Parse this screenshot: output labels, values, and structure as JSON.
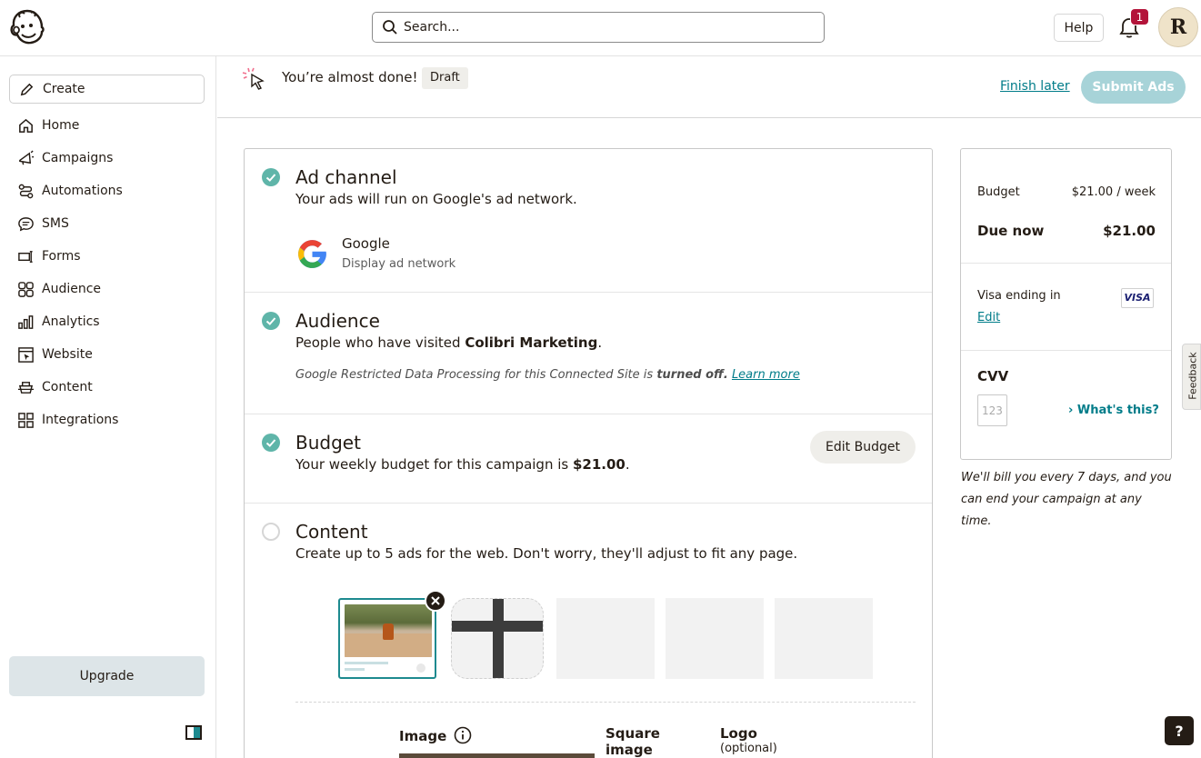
{
  "topbar": {
    "search_placeholder": "Search...",
    "help_label": "Help",
    "notification_count": "1",
    "avatar_initial": "R"
  },
  "sidebar": {
    "create_label": "Create",
    "items": [
      {
        "label": "Home",
        "icon": "home-icon"
      },
      {
        "label": "Campaigns",
        "icon": "megaphone-icon"
      },
      {
        "label": "Automations",
        "icon": "automation-icon"
      },
      {
        "label": "SMS",
        "icon": "chat-icon"
      },
      {
        "label": "Forms",
        "icon": "form-icon"
      },
      {
        "label": "Audience",
        "icon": "audience-icon"
      },
      {
        "label": "Analytics",
        "icon": "bar-chart-icon"
      },
      {
        "label": "Website",
        "icon": "website-icon"
      },
      {
        "label": "Content",
        "icon": "content-icon"
      },
      {
        "label": "Integrations",
        "icon": "grid-icon"
      }
    ],
    "upgrade_label": "Upgrade"
  },
  "header": {
    "status_text": "You’re almost done!",
    "draft_badge": "Draft",
    "finish_later": "Finish later",
    "submit_label": "Submit Ads"
  },
  "sections": {
    "ad_channel": {
      "title": "Ad channel",
      "text": "Your ads will run on Google's ad network.",
      "provider_name": "Google",
      "provider_sub": "Display ad network"
    },
    "audience": {
      "title": "Audience",
      "text_prefix": "People who have visited ",
      "site_name": "Colibri Marketing",
      "text_suffix": ".",
      "note_prefix": "Google Restricted Data Processing for this Connected Site is ",
      "note_bold": "turned off.",
      "note_link": "Learn more"
    },
    "budget": {
      "title": "Budget",
      "text_prefix": "Your weekly budget for this campaign is ",
      "amount": "$21.00",
      "text_suffix": ".",
      "edit_label": "Edit Budget"
    },
    "content": {
      "title": "Content",
      "text": "Create up to 5 ads for the web. Don't worry, they'll adjust to fit any page.",
      "col_image": "Image",
      "col_square_line1": "Square",
      "col_square_line2": "image",
      "col_logo": "Logo",
      "col_logo_sub": "(optional)"
    }
  },
  "summary": {
    "budget_label": "Budget",
    "budget_value": "$21.00 / week",
    "due_label": "Due now",
    "due_value": "$21.00",
    "card_label": "Visa ending in",
    "card_brand": "VISA",
    "edit_label": "Edit",
    "cvv_label": "CVV",
    "cvv_placeholder": "123",
    "whats_this": "What's this?",
    "bill_note": "We'll bill you every 7 days, and you can end your campaign at any time."
  },
  "feedback_label": "Feedback",
  "help_fab": "?",
  "colors": {
    "accent": "#007c89",
    "check_green": "#5fb5a9",
    "submit_disabled": "#a7d3d8",
    "badge_red": "#b3143a"
  }
}
